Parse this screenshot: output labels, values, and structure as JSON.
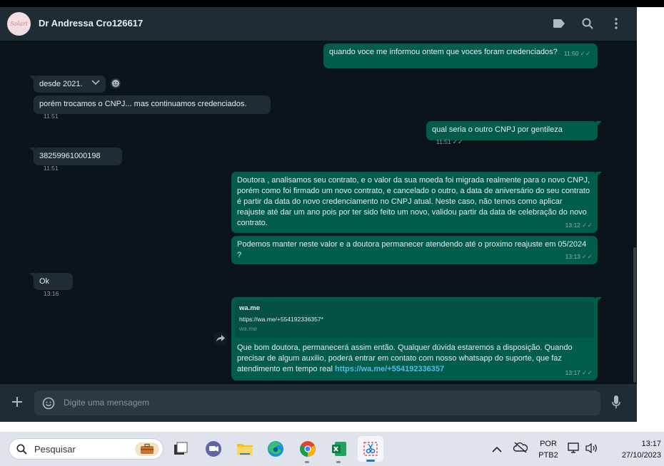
{
  "header": {
    "avatar_text": "Solari",
    "contact_name": "Dr Andressa Cro126617"
  },
  "messages": {
    "m1": {
      "text": "quando voce me informou ontem que voces foram credenciados?",
      "time": "11:50"
    },
    "m2": {
      "text": "desde 2021."
    },
    "m3": {
      "text": "porém trocamos o CNPJ... mas continuamos credenciados.",
      "time": "11:51"
    },
    "m4": {
      "text": "qual seria o outro CNPJ por gentileza",
      "time": "11:51"
    },
    "m5": {
      "text": "38259961000198",
      "time": "11:51"
    },
    "m6": {
      "text": "Doutora , analisamos seu contrato, e o valor da sua moeda foi migrada realmente para o novo CNPJ, porém como foi firmado um novo contrato, e cancelado o outro, a data de aniversário do seu contrato é partir da data do novo credenciamento no CNPJ atual. Neste caso, não temos como aplicar reajuste até dar um ano pois por ter sido feito um novo,  validou partir da data de celebração do novo contrato.",
      "time": "13:12"
    },
    "m7": {
      "text": "Podemos manter neste valor e a doutora permanecer atendendo até o proximo reajuste em 05/2024 ?",
      "time": "13:13"
    },
    "m8": {
      "text": "Ok",
      "time": "13:16"
    },
    "m9": {
      "preview_title": "wa.me",
      "preview_url": "https://wa.me/+554192336357*",
      "preview_domain": "wa.me",
      "text": "Que bom doutora, permanecerá assim então. Qualquer dúvida estaremos a disposição. Quando precisar de algum auxilio, poderá entrar em contato com nosso whatsapp do suporte, que faz atendimento em tempo real ",
      "link": "https://wa.me/+554192336357",
      "time": "13:17"
    }
  },
  "composer": {
    "placeholder": "Digite uma mensagem"
  },
  "taskbar": {
    "search_placeholder": "Pesquisar",
    "lang_top": "POR",
    "lang_bottom": "PTB2",
    "clock_time": "13:17",
    "clock_date": "27/10/2023"
  },
  "colors": {
    "incoming_bubble": "#202c33",
    "outgoing_bubble": "#005c4b",
    "chat_bg": "#0b141a",
    "link": "#53bdeb"
  }
}
